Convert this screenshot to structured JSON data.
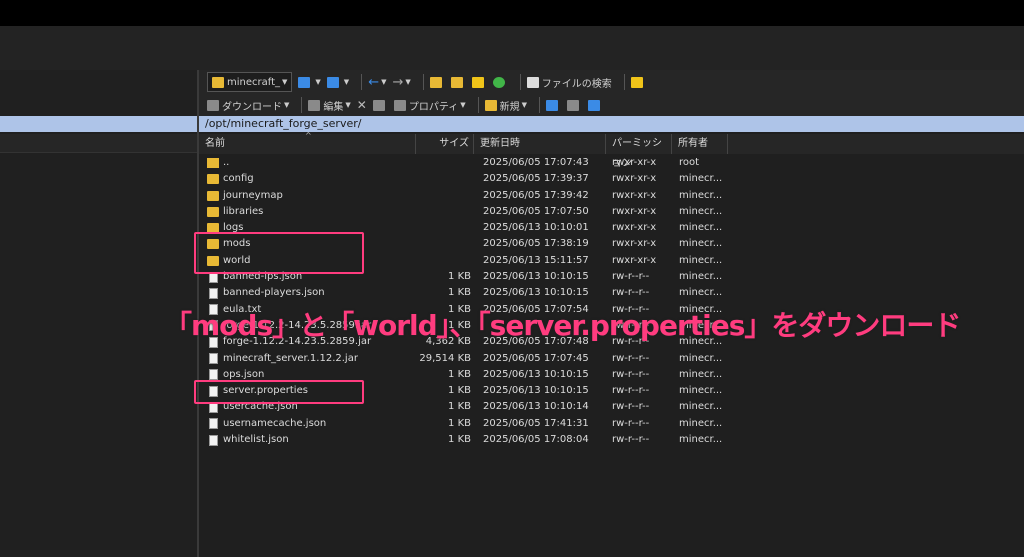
{
  "toolbar1": {
    "folder_label": "minecraft_",
    "find_files_label": "ファイルの検索"
  },
  "toolbar2": {
    "download_label": "ダウンロード",
    "edit_label": "編集",
    "properties_label": "プロパティ",
    "new_label": "新規"
  },
  "path": "/opt/minecraft_forge_server/",
  "columns": {
    "name": "名前",
    "size": "サイズ",
    "modified": "更新日時",
    "permissions": "パーミッション",
    "owner": "所有者"
  },
  "files": [
    {
      "name": "..",
      "type": "up",
      "size": "",
      "date": "2025/06/05 17:07:43",
      "perm": "rwxr-xr-x",
      "owner": "root"
    },
    {
      "name": "config",
      "type": "folder",
      "size": "",
      "date": "2025/06/05 17:39:37",
      "perm": "rwxr-xr-x",
      "owner": "minecr..."
    },
    {
      "name": "journeymap",
      "type": "folder",
      "size": "",
      "date": "2025/06/05 17:39:42",
      "perm": "rwxr-xr-x",
      "owner": "minecr..."
    },
    {
      "name": "libraries",
      "type": "folder",
      "size": "",
      "date": "2025/06/05 17:07:50",
      "perm": "rwxr-xr-x",
      "owner": "minecr..."
    },
    {
      "name": "logs",
      "type": "folder",
      "size": "",
      "date": "2025/06/13 10:10:01",
      "perm": "rwxr-xr-x",
      "owner": "minecr..."
    },
    {
      "name": "mods",
      "type": "folder",
      "size": "",
      "date": "2025/06/05 17:38:19",
      "perm": "rwxr-xr-x",
      "owner": "minecr..."
    },
    {
      "name": "world",
      "type": "folder",
      "size": "",
      "date": "2025/06/13 15:11:57",
      "perm": "rwxr-xr-x",
      "owner": "minecr..."
    },
    {
      "name": "banned-ips.json",
      "type": "file",
      "size": "1 KB",
      "date": "2025/06/13 10:10:15",
      "perm": "rw-r--r--",
      "owner": "minecr..."
    },
    {
      "name": "banned-players.json",
      "type": "file",
      "size": "1 KB",
      "date": "2025/06/13 10:10:15",
      "perm": "rw-r--r--",
      "owner": "minecr..."
    },
    {
      "name": "eula.txt",
      "type": "file",
      "size": "1 KB",
      "date": "2025/06/05 17:07:54",
      "perm": "rw-r--r--",
      "owner": "minecr..."
    },
    {
      "name": "forge-1.12.2-14.23.5.2859.jar",
      "type": "file",
      "size": "1 KB",
      "date": "",
      "perm": "rw-r--r--",
      "owner": "minecr..."
    },
    {
      "name": "forge-1.12.2-14.23.5.2859.jar",
      "type": "file",
      "size": "4,362 KB",
      "date": "2025/06/05 17:07:48",
      "perm": "rw-r--r--",
      "owner": "minecr..."
    },
    {
      "name": "minecraft_server.1.12.2.jar",
      "type": "file",
      "size": "29,514 KB",
      "date": "2025/06/05 17:07:45",
      "perm": "rw-r--r--",
      "owner": "minecr..."
    },
    {
      "name": "ops.json",
      "type": "file",
      "size": "1 KB",
      "date": "2025/06/13 10:10:15",
      "perm": "rw-r--r--",
      "owner": "minecr..."
    },
    {
      "name": "server.properties",
      "type": "file",
      "size": "1 KB",
      "date": "2025/06/13 10:10:15",
      "perm": "rw-r--r--",
      "owner": "minecr..."
    },
    {
      "name": "usercache.json",
      "type": "file",
      "size": "1 KB",
      "date": "2025/06/13 10:10:14",
      "perm": "rw-r--r--",
      "owner": "minecr..."
    },
    {
      "name": "usernamecache.json",
      "type": "file",
      "size": "1 KB",
      "date": "2025/06/05 17:41:31",
      "perm": "rw-r--r--",
      "owner": "minecr..."
    },
    {
      "name": "whitelist.json",
      "type": "file",
      "size": "1 KB",
      "date": "2025/06/05 17:08:04",
      "perm": "rw-r--r--",
      "owner": "minecr..."
    }
  ],
  "annotation": "「mods」と「world」、「server.properties」をダウンロード",
  "highlight_color": "#ff3c7f"
}
